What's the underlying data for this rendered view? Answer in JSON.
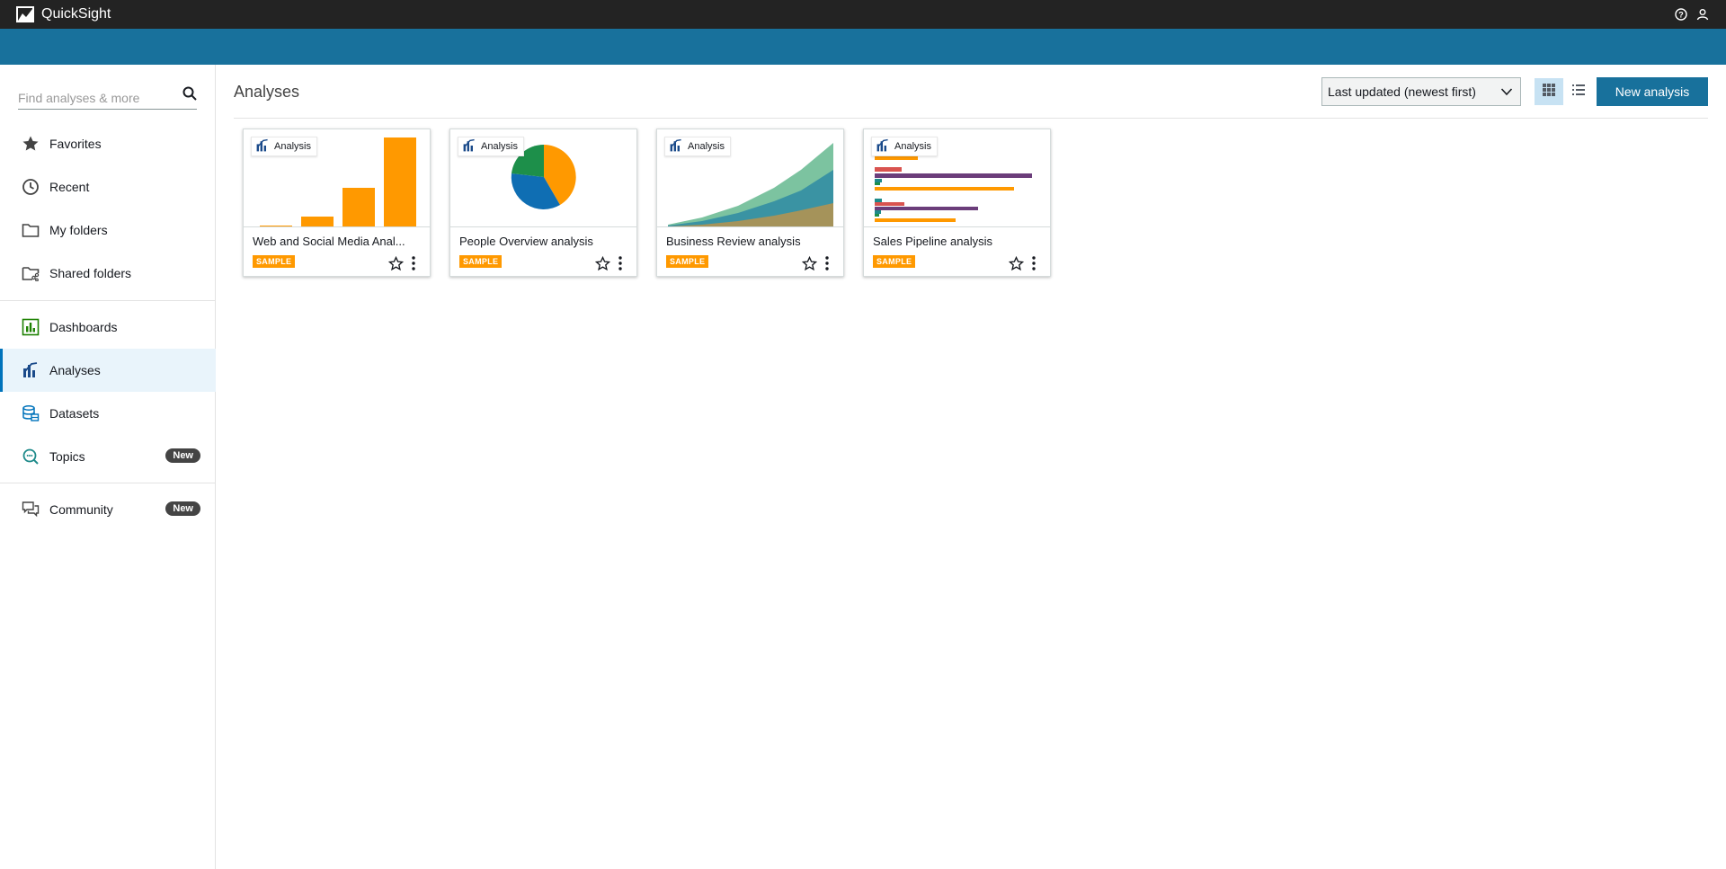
{
  "app": {
    "title": "QuickSight"
  },
  "search": {
    "placeholder": "Find analyses & more"
  },
  "sidebar": {
    "items": [
      {
        "label": "Favorites",
        "icon": "star-icon"
      },
      {
        "label": "Recent",
        "icon": "clock-icon"
      },
      {
        "label": "My folders",
        "icon": "folder-icon"
      },
      {
        "label": "Shared folders",
        "icon": "shared-folder-icon"
      },
      {
        "label": "Dashboards",
        "icon": "dashboard-icon"
      },
      {
        "label": "Analyses",
        "icon": "analysis-icon",
        "active": true
      },
      {
        "label": "Datasets",
        "icon": "dataset-icon"
      },
      {
        "label": "Topics",
        "icon": "topics-icon",
        "badge": "New"
      },
      {
        "label": "Community",
        "icon": "community-icon",
        "badge": "New"
      }
    ]
  },
  "main": {
    "title": "Analyses",
    "sort": {
      "selected": "Last updated (newest first)"
    },
    "new_button": "New analysis"
  },
  "cards": [
    {
      "type_label": "Analysis",
      "title": "Web and Social Media Anal...",
      "badge": "SAMPLE"
    },
    {
      "type_label": "Analysis",
      "title": "People Overview analysis",
      "badge": "SAMPLE"
    },
    {
      "type_label": "Analysis",
      "title": "Business Review analysis",
      "badge": "SAMPLE"
    },
    {
      "type_label": "Analysis",
      "title": "Sales Pipeline analysis",
      "badge": "SAMPLE"
    }
  ],
  "colors": {
    "brand": "#18719c",
    "topbar": "#232323",
    "accent": "#ff9900",
    "active_bg": "#e9f4fb"
  }
}
